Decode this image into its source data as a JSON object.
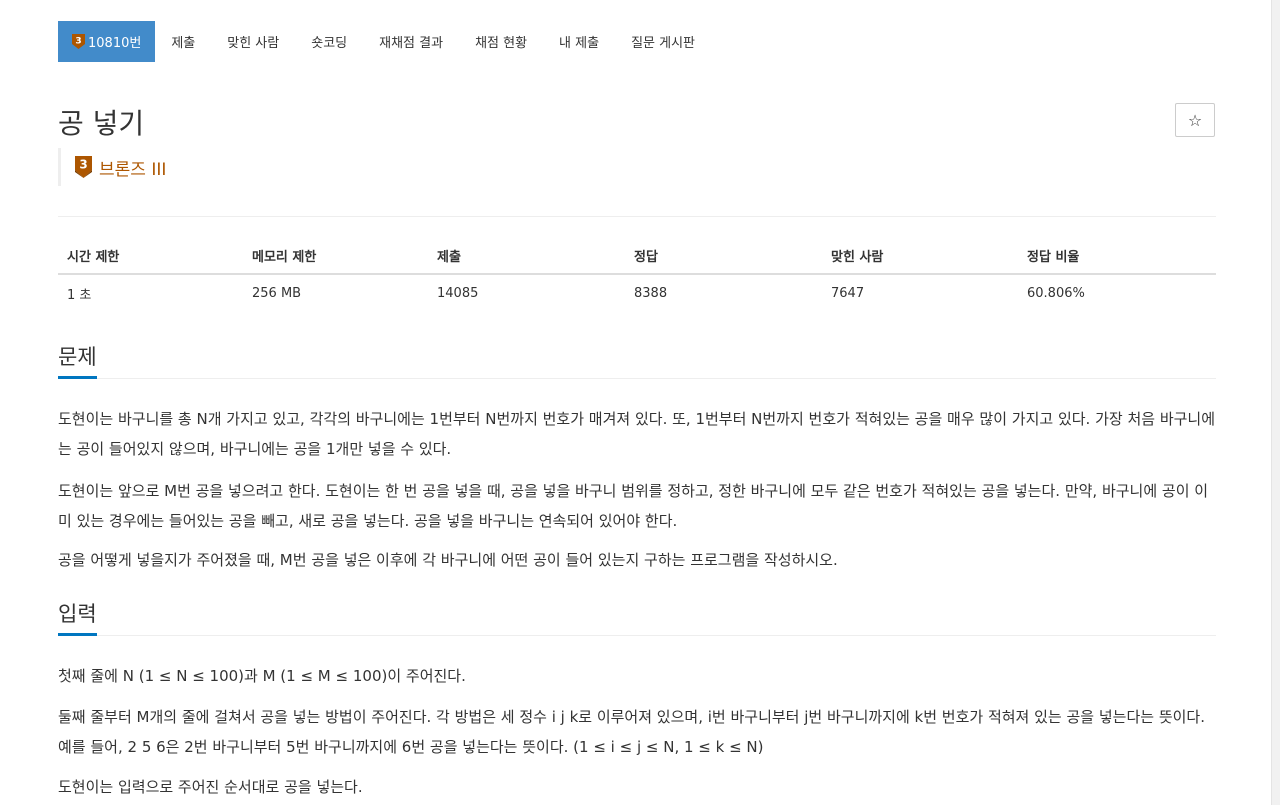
{
  "nav": {
    "problem_number": "10810번",
    "tier_digit": "3",
    "items": [
      "제출",
      "맞힌 사람",
      "숏코딩",
      "재채점 결과",
      "채점 현황",
      "내 제출",
      "질문 게시판"
    ]
  },
  "problem": {
    "title": "공 넣기",
    "star": "☆",
    "tier_digit": "3",
    "tier_label": "브론즈 III",
    "tier_color": "#ad5600"
  },
  "info_table": {
    "headers": [
      "시간 제한",
      "메모리 제한",
      "제출",
      "정답",
      "맞힌 사람",
      "정답 비율"
    ],
    "values": [
      "1 초",
      "256 MB",
      "14085",
      "8388",
      "7647",
      "60.806%"
    ]
  },
  "sections": {
    "description": {
      "heading": "문제",
      "paragraphs": [
        "도현이는 바구니를 총 N개 가지고 있고, 각각의 바구니에는 1번부터 N번까지 번호가 매겨져 있다. 또, 1번부터 N번까지 번호가 적혀있는 공을 매우 많이 가지고 있다. 가장 처음 바구니에는 공이 들어있지 않으며, 바구니에는 공을 1개만 넣을 수 있다.",
        "도현이는 앞으로 M번 공을 넣으려고 한다. 도현이는 한 번 공을 넣을 때, 공을 넣을 바구니 범위를 정하고, 정한 바구니에 모두 같은 번호가 적혀있는 공을 넣는다. 만약, 바구니에 공이 이미 있는 경우에는 들어있는 공을 빼고, 새로 공을 넣는다. 공을 넣을 바구니는 연속되어 있어야 한다.",
        "공을 어떻게 넣을지가 주어졌을 때, M번 공을 넣은 이후에 각 바구니에 어떤 공이 들어 있는지 구하는 프로그램을 작성하시오."
      ]
    },
    "input": {
      "heading": "입력",
      "paragraphs": [
        "첫째 줄에 N (1 ≤ N ≤ 100)과 M (1 ≤ M ≤ 100)이 주어진다.",
        "둘째 줄부터 M개의 줄에 걸쳐서 공을 넣는 방법이 주어진다. 각 방법은 세 정수 i j k로 이루어져 있으며, i번 바구니부터 j번 바구니까지에 k번 번호가 적혀져 있는 공을 넣는다는 뜻이다. 예를 들어, 2 5 6은 2번 바구니부터 5번 바구니까지에 6번 공을 넣는다는 뜻이다. (1 ≤ i ≤ j ≤ N, 1 ≤ k ≤ N)",
        "도현이는 입력으로 주어진 순서대로 공을 넣는다."
      ]
    }
  },
  "colors": {
    "nav_active_bg": "#428bca",
    "heading_underline": "#0076c0",
    "bronze": "#ad5600"
  }
}
